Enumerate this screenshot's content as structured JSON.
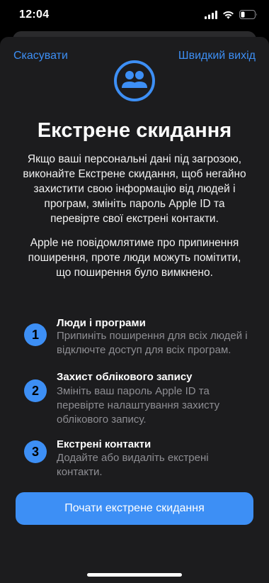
{
  "status_bar": {
    "time": "12:04",
    "icons": [
      "signal-icon",
      "wifi-icon",
      "battery-icon"
    ]
  },
  "nav": {
    "cancel_label": "Скасувати",
    "quick_exit_label": "Швидкий вихід"
  },
  "hero": {
    "icon": "people-icon"
  },
  "title": "Екстрене скидання",
  "description": "Якщо ваші персональні дані під загрозою, виконайте Екстрене скидання, щоб негайно захистити свою інформацію від людей і програм, змініть пароль Apple ID та перевірте свої екстрені контакти.",
  "note": "Apple не повідомлятиме про припинення поширення, проте люди можуть помітити, що поширення було вимкнено.",
  "steps": [
    {
      "number": "1",
      "title": "Люди і програми",
      "description": "Припиніть поширення для всіх людей і відключте доступ для всіх програм."
    },
    {
      "number": "2",
      "title": "Захист облікового запису",
      "description": "Змініть ваш пароль Apple ID та перевірте налаштування захисту облікового запису."
    },
    {
      "number": "3",
      "title": "Екстрені контакти",
      "description": "Додайте або видаліть екстрені контакти."
    }
  ],
  "primary_button_label": "Почати екстрене скидання",
  "colors": {
    "accent": "#3d8ff5",
    "sheet_background": "#1c1c1e",
    "secondary_text": "#8e8e93"
  }
}
